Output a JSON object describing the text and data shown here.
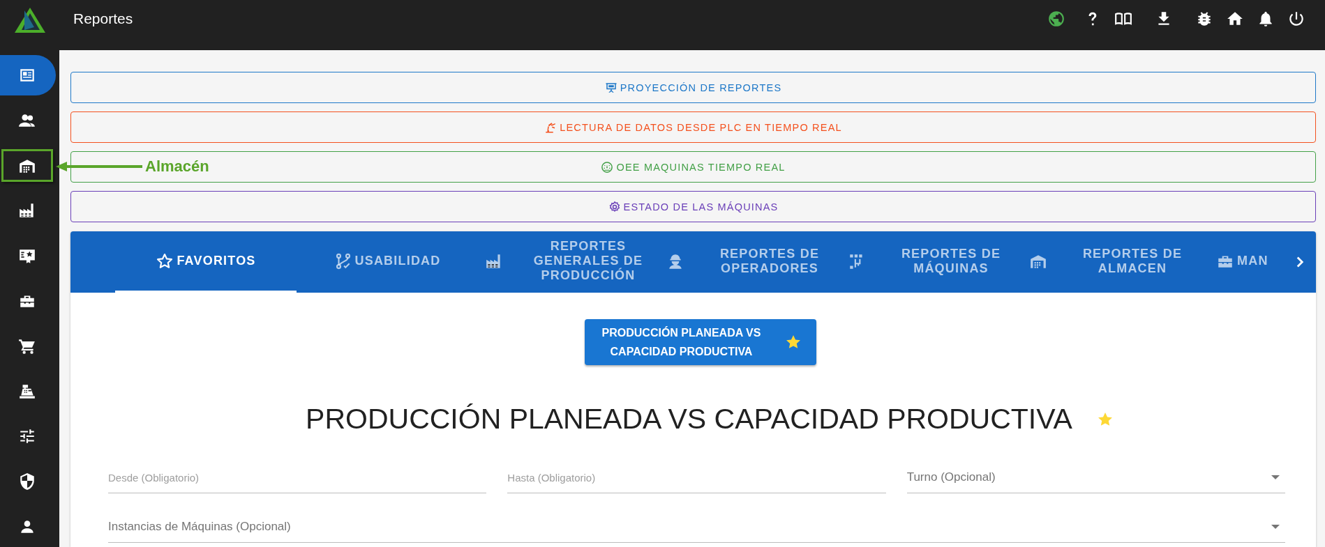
{
  "topbar": {
    "title": "Reportes"
  },
  "sidebar": {
    "items": [
      {
        "selected": true
      },
      {
        "selected": false
      },
      {
        "selected": false
      },
      {
        "selected": false
      },
      {
        "selected": false
      },
      {
        "selected": false
      },
      {
        "selected": false
      },
      {
        "selected": false
      },
      {
        "selected": false
      },
      {
        "selected": false
      },
      {
        "selected": false
      }
    ]
  },
  "annotation": {
    "label": "Almacén"
  },
  "report_links": [
    {
      "label": "PROYECCIÓN DE REPORTES",
      "color": "#1e78c8"
    },
    {
      "label": "LECTURA DE DATOS DESDE PLC EN TIEMPO REAL",
      "color": "#f4511e"
    },
    {
      "label": "OEE MAQUINAS TIEMPO REAL",
      "color": "#43a047"
    },
    {
      "label": "ESTADO DE LAS MÁQUINAS",
      "color": "#6a3fb8"
    }
  ],
  "tabs": [
    {
      "label": "FAVORITOS",
      "selected": true
    },
    {
      "label": "USABILIDAD",
      "selected": false
    },
    {
      "label": "REPORTES GENERALES DE PRODUCCIÓN",
      "selected": false
    },
    {
      "label": "REPORTES DE OPERADORES",
      "selected": false
    },
    {
      "label": "REPORTES DE MÁQUINAS",
      "selected": false
    },
    {
      "label": "REPORTES DE ALMACEN",
      "selected": false
    },
    {
      "label": "MAN",
      "selected": false
    }
  ],
  "favorite_chips": [
    {
      "label": "PRODUCCIÓN PLANEADA VS CAPACIDAD PRODUCTIVA",
      "starred": true
    }
  ],
  "report": {
    "title": "PRODUCCIÓN PLANEADA VS CAPACIDAD PRODUCTIVA",
    "starred": true,
    "fields": [
      {
        "kind": "text",
        "placeholder": "Desde (Obligatorio)"
      },
      {
        "kind": "text",
        "placeholder": "Hasta (Obligatorio)"
      },
      {
        "kind": "select",
        "placeholder": "Turno (Opcional)"
      },
      {
        "kind": "select",
        "placeholder": "Instancias de Máquinas (Opcional)"
      }
    ]
  }
}
